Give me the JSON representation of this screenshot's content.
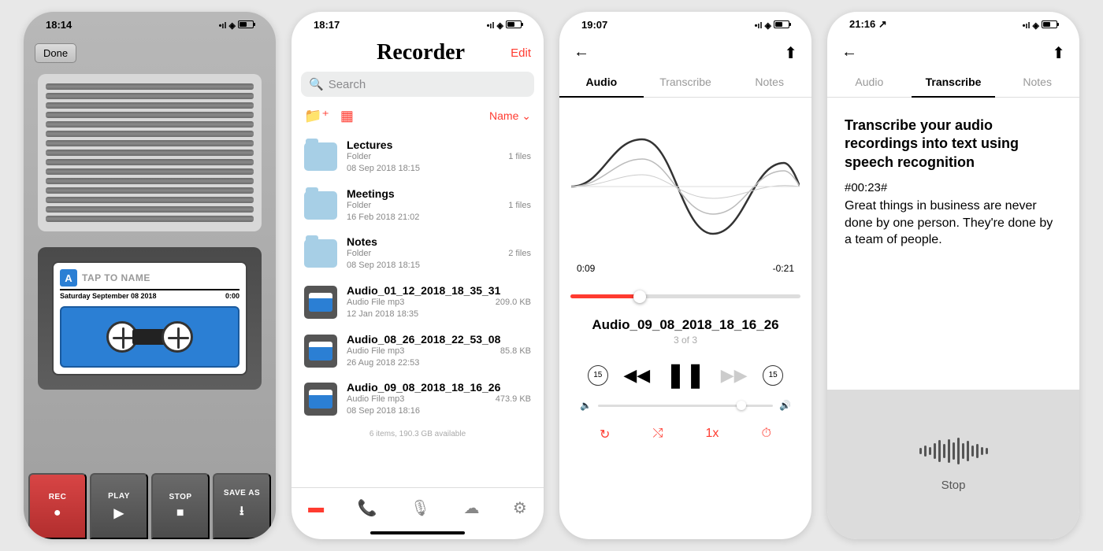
{
  "screen1": {
    "status_time": "18:14",
    "done": "Done",
    "cassette_letter": "A",
    "tap_to_name": "TAP TO NAME",
    "date": "Saturday September 08 2018",
    "counter": "0:00",
    "buttons": {
      "rec": "REC",
      "play": "PLAY",
      "stop": "STOP",
      "save": "SAVE AS"
    }
  },
  "screen2": {
    "status_time": "18:17",
    "title": "Recorder",
    "edit": "Edit",
    "search_placeholder": "Search",
    "sort": "Name",
    "items": [
      {
        "title": "Lectures",
        "sub1": "Folder",
        "sub2": "08 Sep 2018 18:15",
        "meta": "1 files",
        "type": "folder"
      },
      {
        "title": "Meetings",
        "sub1": "Folder",
        "sub2": "16 Feb 2018 21:02",
        "meta": "1 files",
        "type": "folder"
      },
      {
        "title": "Notes",
        "sub1": "Folder",
        "sub2": "08 Sep 2018 18:15",
        "meta": "2 files",
        "type": "folder"
      },
      {
        "title": "Audio_01_12_2018_18_35_31",
        "sub1": "Audio File mp3",
        "sub2": "12 Jan 2018 18:35",
        "meta": "209.0 KB",
        "type": "audio"
      },
      {
        "title": "Audio_08_26_2018_22_53_08",
        "sub1": "Audio File mp3",
        "sub2": "26 Aug 2018 22:53",
        "meta": "85.8 KB",
        "type": "audio"
      },
      {
        "title": "Audio_09_08_2018_18_16_26",
        "sub1": "Audio File mp3",
        "sub2": "08 Sep 2018 18:16",
        "meta": "473.9 KB",
        "type": "audio"
      }
    ],
    "footer": "6 items, 190.3 GB available"
  },
  "screen3": {
    "status_time": "19:07",
    "tabs": {
      "audio": "Audio",
      "transcribe": "Transcribe",
      "notes": "Notes"
    },
    "elapsed": "0:09",
    "remaining": "-0:21",
    "track": "Audio_09_08_2018_18_16_26",
    "track_sub": "3 of 3",
    "speed": "1x",
    "skip_back": "15",
    "skip_fwd": "15"
  },
  "screen4": {
    "status_time": "21:16",
    "tabs": {
      "audio": "Audio",
      "transcribe": "Transcribe",
      "notes": "Notes"
    },
    "heading": "Transcribe your audio recordings into text using speech recognition",
    "timestamp": "#00:23#",
    "body": "Great things in business are never done by one person. They're done by a team of people.",
    "stop": "Stop"
  }
}
